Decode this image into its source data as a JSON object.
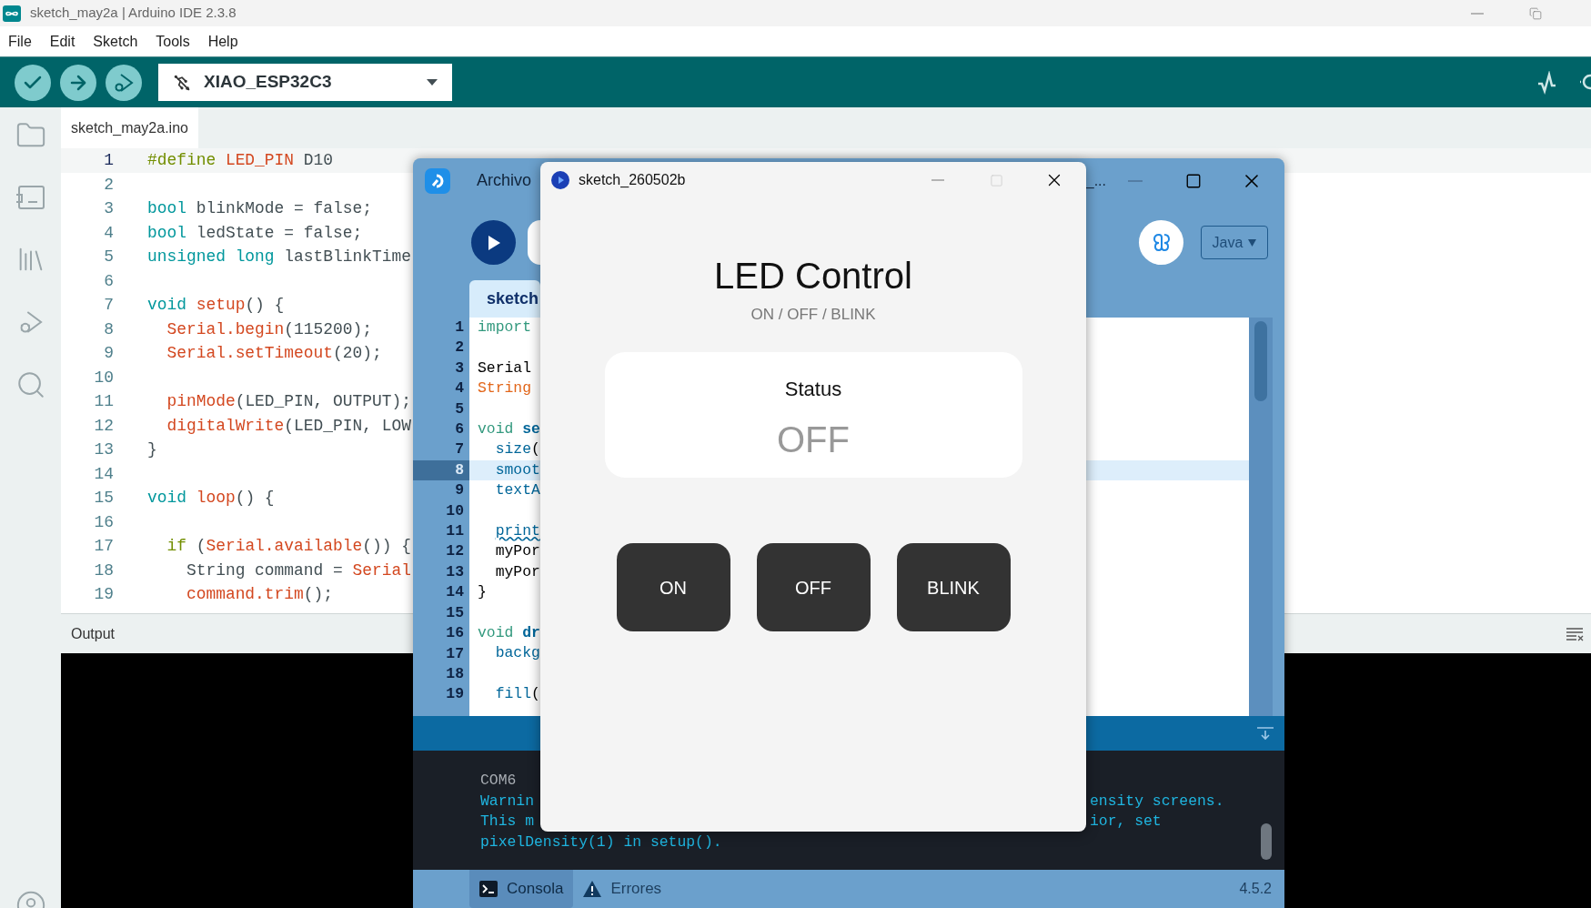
{
  "arduino": {
    "title": "sketch_may2a | Arduino IDE 2.3.8",
    "menu": [
      "File",
      "Edit",
      "Sketch",
      "Tools",
      "Help"
    ],
    "board": "XIAO_ESP32C3",
    "tab": {
      "label": "sketch_may2a.ino",
      "selected": true
    },
    "lines": [
      {
        "number": "1",
        "current": true,
        "tokens": [
          {
            "kind": "directive",
            "text": "#define"
          },
          {
            "kind": "fn",
            "text": " LED_PIN"
          },
          {
            "kind": "plain",
            "text": " D10"
          }
        ]
      },
      {
        "number": "2",
        "current": false
      },
      {
        "number": "3",
        "current": false,
        "tokens": [
          {
            "kind": "type",
            "text": "bool"
          },
          {
            "kind": "plain",
            "text": " blinkMode = false;"
          }
        ]
      },
      {
        "number": "4",
        "current": false,
        "tokens": [
          {
            "kind": "type",
            "text": "bool"
          },
          {
            "kind": "plain",
            "text": " ledState = false;"
          }
        ]
      },
      {
        "number": "5",
        "current": false,
        "tokens": [
          {
            "kind": "type",
            "text": "unsigned long"
          },
          {
            "kind": "plain",
            "text": " lastBlinkTime"
          }
        ]
      },
      {
        "number": "6",
        "current": false
      },
      {
        "number": "7",
        "current": false,
        "tokens": [
          {
            "kind": "type",
            "text": "void"
          },
          {
            "kind": "fn",
            "text": " setup"
          },
          {
            "kind": "plain",
            "text": "() {"
          }
        ]
      },
      {
        "number": "8",
        "current": false,
        "tokens": [
          {
            "kind": "fn",
            "text": "  Serial.begin"
          },
          {
            "kind": "plain",
            "text": "(115200);"
          }
        ]
      },
      {
        "number": "9",
        "current": false,
        "tokens": [
          {
            "kind": "fn",
            "text": "  Serial.setTimeout"
          },
          {
            "kind": "plain",
            "text": "(20);"
          }
        ]
      },
      {
        "number": "10",
        "current": false
      },
      {
        "number": "11",
        "current": false,
        "tokens": [
          {
            "kind": "fn",
            "text": "  pinMode"
          },
          {
            "kind": "plain",
            "text": "(LED_PIN, OUTPUT);"
          }
        ]
      },
      {
        "number": "12",
        "current": false,
        "tokens": [
          {
            "kind": "fn",
            "text": "  digitalWrite"
          },
          {
            "kind": "plain",
            "text": "(LED_PIN, LOW"
          }
        ]
      },
      {
        "number": "13",
        "current": false,
        "tokens": [
          {
            "kind": "plain",
            "text": "}"
          }
        ]
      },
      {
        "number": "14",
        "current": false
      },
      {
        "number": "15",
        "current": false,
        "tokens": [
          {
            "kind": "type",
            "text": "void"
          },
          {
            "kind": "fn",
            "text": " loop"
          },
          {
            "kind": "plain",
            "text": "() {"
          }
        ]
      },
      {
        "number": "16",
        "current": false
      },
      {
        "number": "17",
        "current": false,
        "tokens": [
          {
            "kind": "directive",
            "text": "  if"
          },
          {
            "kind": "plain",
            "text": " ("
          },
          {
            "kind": "fn",
            "text": "Serial.available"
          },
          {
            "kind": "plain",
            "text": "()) {"
          }
        ]
      },
      {
        "number": "18",
        "current": false,
        "tokens": [
          {
            "kind": "plain",
            "text": "    String command = "
          },
          {
            "kind": "fn",
            "text": "Serial"
          }
        ]
      },
      {
        "number": "19",
        "current": false,
        "tokens": [
          {
            "kind": "fn",
            "text": "    command.trim"
          },
          {
            "kind": "plain",
            "text": "();"
          }
        ]
      }
    ],
    "output_label": "Output"
  },
  "processing": {
    "menu_item": "Archivo",
    "title_visible": "_...",
    "mode": "Java",
    "tab": "sketch",
    "lines": [
      {
        "number": "1",
        "current": false,
        "tokens": [
          {
            "kind": "keyword",
            "text": "import"
          }
        ]
      },
      {
        "number": "2",
        "current": false
      },
      {
        "number": "3",
        "current": false,
        "tokens": [
          {
            "kind": "plain",
            "text": "Serial"
          }
        ]
      },
      {
        "number": "4",
        "current": false,
        "tokens": [
          {
            "kind": "type",
            "text": "String"
          }
        ]
      },
      {
        "number": "5",
        "current": false
      },
      {
        "number": "6",
        "current": false,
        "tokens": [
          {
            "kind": "keyword",
            "text": "void"
          },
          {
            "kind": "bold",
            "text": " se"
          }
        ]
      },
      {
        "number": "7",
        "current": false,
        "tokens": [
          {
            "kind": "fn",
            "text": "  size"
          },
          {
            "kind": "plain",
            "text": "("
          }
        ]
      },
      {
        "number": "8",
        "current": true,
        "tokens": [
          {
            "kind": "fn",
            "text": "  smoot"
          }
        ]
      },
      {
        "number": "9",
        "current": false,
        "tokens": [
          {
            "kind": "fn",
            "text": "  textA"
          }
        ]
      },
      {
        "number": "10",
        "current": false
      },
      {
        "number": "11",
        "current": false,
        "tokens": [
          {
            "kind": "flagged",
            "text": "  print"
          }
        ]
      },
      {
        "number": "12",
        "current": false,
        "tokens": [
          {
            "kind": "plain",
            "text": "  myPor"
          }
        ]
      },
      {
        "number": "13",
        "current": false,
        "tokens": [
          {
            "kind": "plain",
            "text": "  myPor"
          }
        ]
      },
      {
        "number": "14",
        "current": false,
        "tokens": [
          {
            "kind": "plain",
            "text": "}"
          }
        ]
      },
      {
        "number": "15",
        "current": false
      },
      {
        "number": "16",
        "current": false,
        "tokens": [
          {
            "kind": "keyword",
            "text": "void"
          },
          {
            "kind": "bold",
            "text": " dr"
          }
        ]
      },
      {
        "number": "17",
        "current": false,
        "tokens": [
          {
            "kind": "fn",
            "text": "  backg"
          }
        ]
      },
      {
        "number": "18",
        "current": false
      },
      {
        "number": "19",
        "current": false,
        "tokens": [
          {
            "kind": "fn",
            "text": "  fill"
          },
          {
            "kind": "plain",
            "text": "("
          }
        ]
      }
    ],
    "console": [
      {
        "kind": "info",
        "text": "COM6"
      },
      {
        "kind": "warning",
        "text": "Warnin",
        "tail": "ensity screens."
      },
      {
        "kind": "warning",
        "text": "This m",
        "tail": "ior, set"
      },
      {
        "kind": "warning",
        "text": "pixelDensity(1) in setup()."
      }
    ],
    "bottom_tabs": [
      {
        "kind": "console",
        "label": "Consola",
        "selected": true
      },
      {
        "kind": "errors",
        "label": "Errores",
        "selected": false
      }
    ],
    "version": "4.5.2"
  },
  "sketch_window": {
    "title": "sketch_260502b",
    "heading": "LED Control",
    "subtitle": "ON / OFF / BLINK",
    "status_label": "Status",
    "status_value": "OFF",
    "buttons": [
      "ON",
      "OFF",
      "BLINK"
    ]
  }
}
